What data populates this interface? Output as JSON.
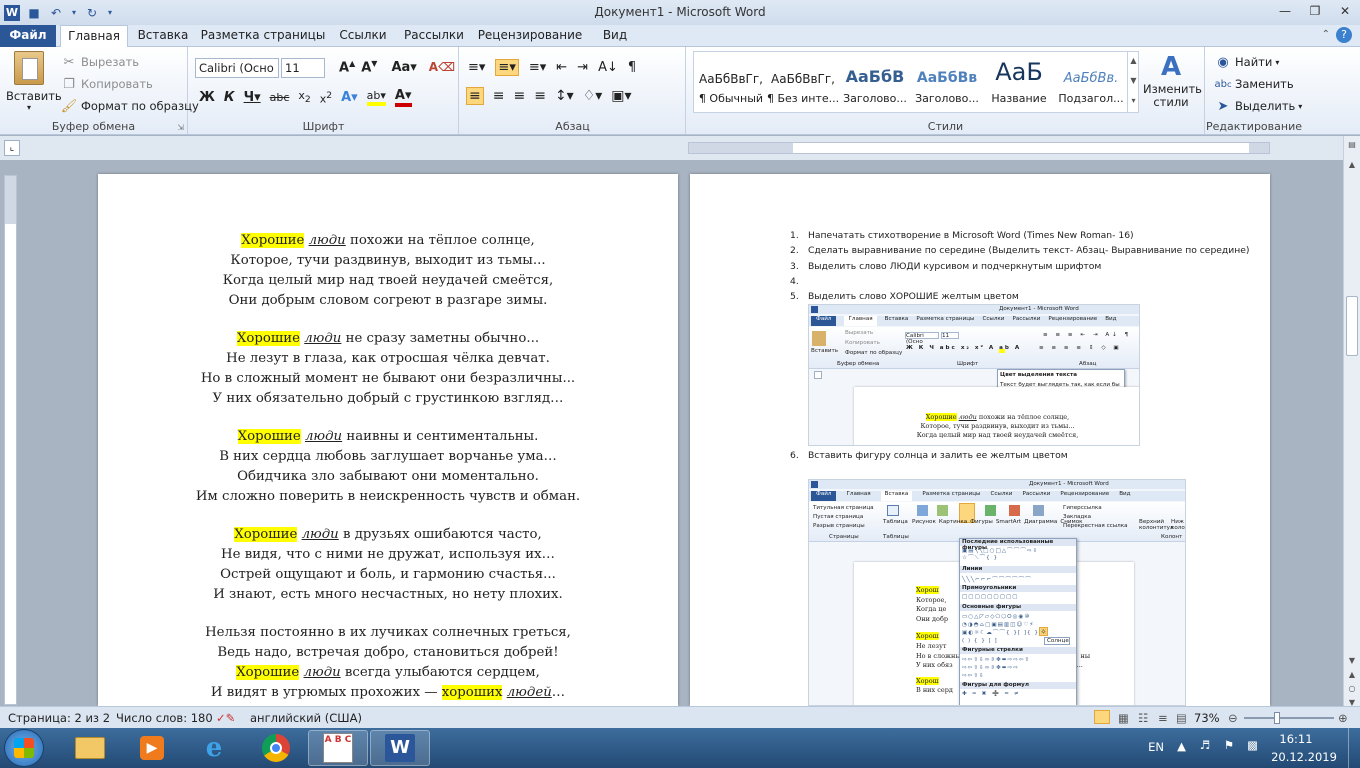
{
  "app": {
    "title": "Документ1  -  Microsoft Word",
    "tabs": [
      {
        "label": "Файл"
      },
      {
        "label": "Главная"
      },
      {
        "label": "Вставка"
      },
      {
        "label": "Разметка страницы"
      },
      {
        "label": "Ссылки"
      },
      {
        "label": "Рассылки"
      },
      {
        "label": "Рецензирование"
      },
      {
        "label": "Вид"
      }
    ]
  },
  "ribbon": {
    "clipboard": {
      "group": "Буфер обмена",
      "paste": "Вставить",
      "cut": "Вырезать",
      "copy": "Копировать",
      "format_painter": "Формат по образцу"
    },
    "font": {
      "group": "Шрифт",
      "font_name": "Calibri (Осно",
      "font_size": "11"
    },
    "paragraph": {
      "group": "Абзац"
    },
    "styles": {
      "group": "Стили",
      "items": [
        {
          "preview": "АаБбВвГг,",
          "name": "¶ Обычный"
        },
        {
          "preview": "АаБбВвГг,",
          "name": "¶ Без инте..."
        },
        {
          "preview": "АаБбВ",
          "name": "Заголово..."
        },
        {
          "preview": "АаБбВв",
          "name": "Заголово..."
        },
        {
          "preview": "АаБ",
          "name": "Название"
        },
        {
          "preview": "АаБбВв.",
          "name": "Подзагол..."
        }
      ],
      "change": "Изменить стили"
    },
    "editing": {
      "group": "Редактирование",
      "find": "Найти",
      "replace": "Заменить",
      "select": "Выделить"
    }
  },
  "page1": {
    "stanza1": {
      "l1_hl": "Хорошие",
      "l1_it": "люди",
      "l1_rest": " похожи на тёплое солнце,",
      "l2": "Которое, тучи раздвинув, выходит из тьмы...",
      "l3": "Когда целый мир над твоей неудачей смеётся,",
      "l4": "Они добрым словом согреют в разгаре зимы."
    },
    "stanza2": {
      "l1_hl": "Хорошие",
      "l1_it": "люди",
      "l1_rest": " не сразу заметны обычно...",
      "l2": "Не лезут в глаза, как отросшая чёлка девчат.",
      "l3": "Но в сложный момент не бывают они безразличны...",
      "l4": "У них обязательно добрый с грустинкою взгляд…"
    },
    "stanza3": {
      "l1_hl": "Хорошие",
      "l1_it": "люди",
      "l1_rest": " наивны и сентиментальны.",
      "l2": "В них сердца любовь заглушает ворчанье ума…",
      "l3": "Обидчика зло забывают они моментально.",
      "l4": "Им сложно поверить в неискренность чувств и обман."
    },
    "stanza4": {
      "l1_hl": "Хорошие",
      "l1_it": "люди",
      "l1_rest": " в друзьях ошибаются часто,",
      "l2": "Не видя, что с ними не дружат, используя их…",
      "l3": "Острей ощущают и боль, и гармонию счастья...",
      "l4": "И знают, есть много несчастных, но нету плохих."
    },
    "stanza5": {
      "l1": "Нельзя постоянно в их лучиках солнечных греться,",
      "l2": "Ведь надо, встречая добро, становиться добрей!",
      "l3_hl": "Хорошие",
      "l3_it": "люди",
      "l3_rest": " всегда улыбаются сердцем,",
      "l4_a": "И видят в угрюмых прохожих — ",
      "l4_hl": "хороших",
      "l4_it": "людей",
      "l4_b": "…"
    }
  },
  "page2": {
    "tasks": [
      {
        "num": "1.",
        "text": "Напечатать стихотворение в Microsoft Word (Times New Roman- 16)"
      },
      {
        "num": "2.",
        "text": "Сделать выравнивание по середине (Выделить текст- Абзац- Выравнивание по середине)"
      },
      {
        "num": "3.",
        "text": "Выделить слово  ЛЮДИ курсивом и подчеркнутым шрифтом"
      },
      {
        "num": "4.",
        "text": ""
      },
      {
        "num": "5.",
        "text": "Выделить слово ХОРОШИЕ желтым цветом"
      }
    ],
    "task6": {
      "num": "6.",
      "text": "Вставить фигуру солнца и залить ее желтым цветом"
    },
    "shot1": {
      "title": "Документ1 - Microsoft Word",
      "tabs": [
        "Файл",
        "Главная",
        "Вставка",
        "Разметка страницы",
        "Ссылки",
        "Рассылки",
        "Рецензирование",
        "Вид"
      ],
      "clip_items": [
        "Вырезать",
        "Копировать",
        "Формат по образцу"
      ],
      "paste": "Вставить",
      "groups": [
        "Буфер обмена",
        "Шрифт",
        "Абзац"
      ],
      "font_name": "Calibri (Осно",
      "font_size": "11",
      "tooltip_title": "Цвет выделения текста",
      "tooltip_body": "Текст будет выглядеть так, как если бы он был закрашен фломастером.",
      "poem_l1_hl": "Хорошие",
      "poem_l1_it": "люди",
      "poem_l1_rest": " похожи на тёплое солнце,",
      "poem_l2": "Которое, тучи раздвинув, выходит из тьмы...",
      "poem_l3": "Когда целый мир над твоей неудачей смеётся,"
    },
    "shot2": {
      "title": "Документ1 - Microsoft Word",
      "tabs": [
        "Файл",
        "Главная",
        "Вставка",
        "Разметка страницы",
        "Ссылки",
        "Рассылки",
        "Рецензирование",
        "Вид"
      ],
      "left_items": [
        "Титульная страница",
        "Пустая страница",
        "Разрыв страницы"
      ],
      "left_group": "Страницы",
      "table": "Таблица",
      "table_group": "Таблицы",
      "buttons": [
        "Рисунок",
        "Картинка",
        "Фигуры",
        "SmartArt",
        "Диаграмма",
        "Снимок"
      ],
      "link_items": [
        "Гиперссылка",
        "Закладка",
        "Перекрестная ссылка"
      ],
      "header_btn": "Верхний колонтитул",
      "header_btn2": "Ниж колон",
      "header_group": "Колонт",
      "menu_sections": [
        "Последние использованные фигуры",
        "Линии",
        "Прямоугольники",
        "Основные фигуры",
        "Фигурные стрелки",
        "Фигуры для формул"
      ],
      "tooltip": "Солнце",
      "poem_hl": "Хорош",
      "poem_l2": "Которое,",
      "poem_l3": "Когда це",
      "poem_l4": "Они добр",
      "poem_hl2": "Хорош",
      "poem_l6": "Не лезут",
      "poem_l7": "Но в сложны",
      "poem_l7b": "ны",
      "poem_l8": "У них обяз",
      "poem_l8b": "д...",
      "poem_hl3": "Хорош",
      "poem_l10": "В них серд"
    }
  },
  "status": {
    "page": "Страница: 2 из 2",
    "words": "Число слов: 180",
    "lang": "английский (США)",
    "zoom": "73%"
  },
  "taskbar": {
    "lang": "EN",
    "time": "16:11",
    "date": "20.12.2019",
    "abc_label": "A B C"
  },
  "colors": {
    "accent": "#2b5797",
    "highlight": "#ffff00",
    "ribbon": "#dfe9f5"
  }
}
